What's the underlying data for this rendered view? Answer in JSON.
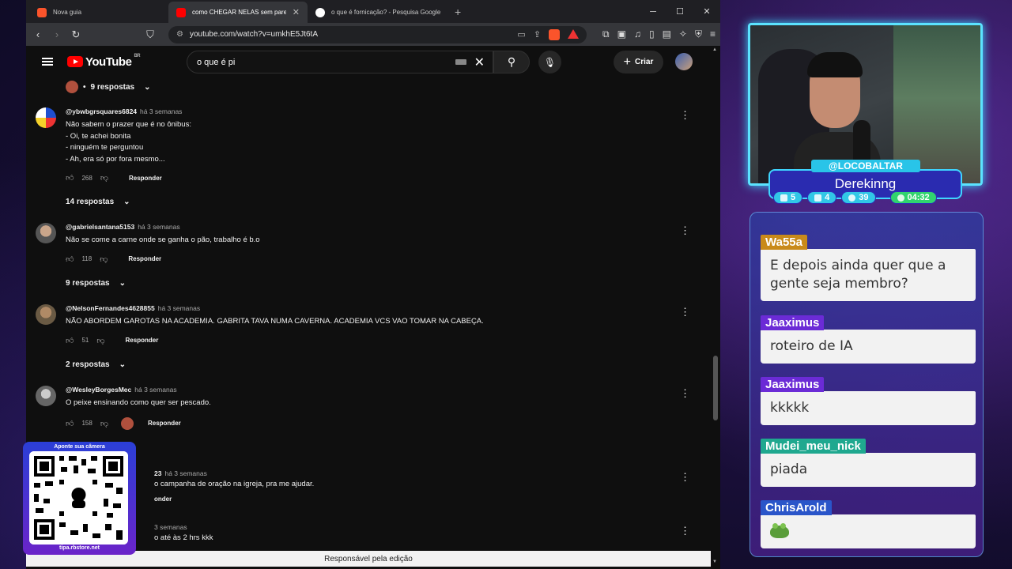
{
  "browser": {
    "tabs": [
      {
        "label": "Nova guia",
        "fav_color": "#fb542b"
      },
      {
        "label": "como CHEGAR NELAS sem parecer um",
        "fav_color": "#ff0000"
      },
      {
        "label": "o que é fornicação? - Pesquisa Google",
        "fav_color": "#4285f4"
      }
    ],
    "new_tab": "+",
    "url": "youtube.com/watch?v=umkhE5Jt6tA"
  },
  "youtube": {
    "logo": "YouTube",
    "region": "BR",
    "search_value": "o que é pi",
    "create_label": "Criar"
  },
  "comments": [
    {
      "replies_label": "9 respostas"
    },
    {
      "author": "@ybwbgrsquares6824",
      "time": "há 3 semanas",
      "text": "Não sabem o prazer que é no ônibus:\n - Oi, te achei bonita\n- ninguém te perguntou\n- Ah, era só por fora mesmo...",
      "likes": "268",
      "reply_label": "Responder",
      "replies": "14 respostas"
    },
    {
      "author": "@gabrielsantana5153",
      "time": "há 3 semanas",
      "text": "Não se come a carne onde se ganha o pão, trabalho é b.o",
      "likes": "118",
      "reply_label": "Responder",
      "replies": "9 respostas"
    },
    {
      "author": "@NelsonFernandes4628855",
      "time": "há 3 semanas",
      "text": "NÃO ABORDEM GAROTAS NA ACADEMIA. GABRITA TAVA NUMA CAVERNA. ACADEMIA VCS VAO TOMAR NA CABEÇA.",
      "likes": "51",
      "reply_label": "Responder",
      "replies": "2 respostas"
    },
    {
      "author": "@WesleyBorgesMec",
      "time": "há 3 semanas",
      "text": "O peixe ensinando como quer ser pescado.",
      "likes": "158",
      "reply_label": "Responder"
    },
    {
      "author": "23",
      "time": "há 3 semanas",
      "text": "o campanha de oração na igreja, pra me ajudar.",
      "reply_label": "onder"
    },
    {
      "time": "3 semanas",
      "text": "o até às 2 hrs kkk"
    }
  ],
  "editor_bar": "Responsável pela edição",
  "qr": {
    "title": "Aponte sua câmera",
    "url": "tipa.rbstore.net"
  },
  "streamer": {
    "handle": "@LOCOBALTAR",
    "name": "Derekinng",
    "stats": [
      "5",
      "4",
      "39",
      "04:32"
    ]
  },
  "chat": [
    {
      "user": "Wa55a",
      "color": "#c98a1a",
      "text": "E depois ainda quer que a gente seja membro?"
    },
    {
      "user": "Jaaximus",
      "color": "#6b2bd6",
      "text": "roteiro de IA"
    },
    {
      "user": "Jaaximus",
      "color": "#6b2bd6",
      "text": "kkkkk"
    },
    {
      "user": "Mudei_meu_nick",
      "color": "#1fa88f",
      "text": "piada"
    },
    {
      "user": "ChrisArold",
      "color": "#2a55c9",
      "text": ""
    }
  ]
}
